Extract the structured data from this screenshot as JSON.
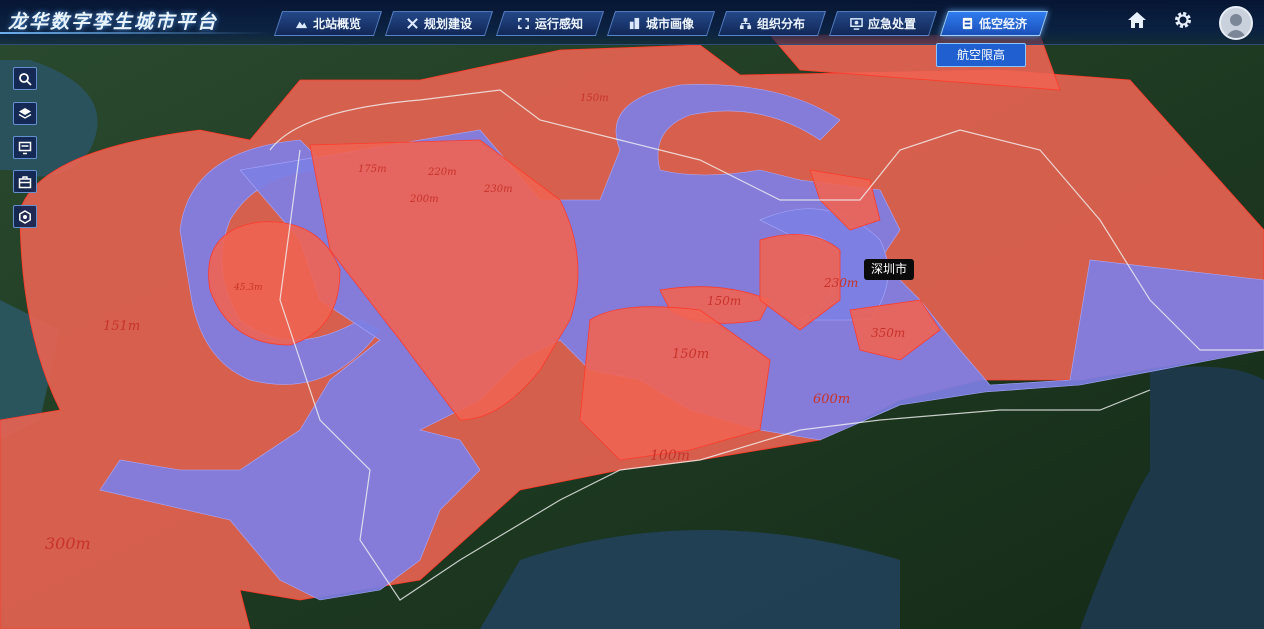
{
  "app": {
    "title": "龙华数字孪生城市平台"
  },
  "nav": {
    "items": [
      {
        "label": "北站概览",
        "icon": "overview-icon",
        "active": false
      },
      {
        "label": "规划建设",
        "icon": "tools-icon",
        "active": false
      },
      {
        "label": "运行感知",
        "icon": "sensor-icon",
        "active": false
      },
      {
        "label": "城市画像",
        "icon": "building-icon",
        "active": false
      },
      {
        "label": "组织分布",
        "icon": "org-chart-icon",
        "active": false
      },
      {
        "label": "应急处置",
        "icon": "monitor-icon",
        "active": false
      },
      {
        "label": "低空经济",
        "icon": "drone-icon",
        "active": true
      }
    ],
    "submenu_label": "航空限高"
  },
  "header_buttons": [
    "home-icon",
    "gear-icon",
    "user-avatar-icon"
  ],
  "toolbar": [
    "search-icon",
    "layers-icon",
    "screen-icon",
    "toolbox-icon",
    "settings-icon"
  ],
  "map": {
    "tooltip": "深圳市",
    "height_labels": [
      "175m",
      "220m",
      "200m",
      "230m",
      "45.3m",
      "151m",
      "150m",
      "230m",
      "150m",
      "350m",
      "600m",
      "100m",
      "300m",
      "150m"
    ]
  },
  "colors": {
    "restricted_zone": "#ef6453",
    "clearance_zone": "#7d7fe4",
    "active_tab": "#2f7cf0"
  }
}
